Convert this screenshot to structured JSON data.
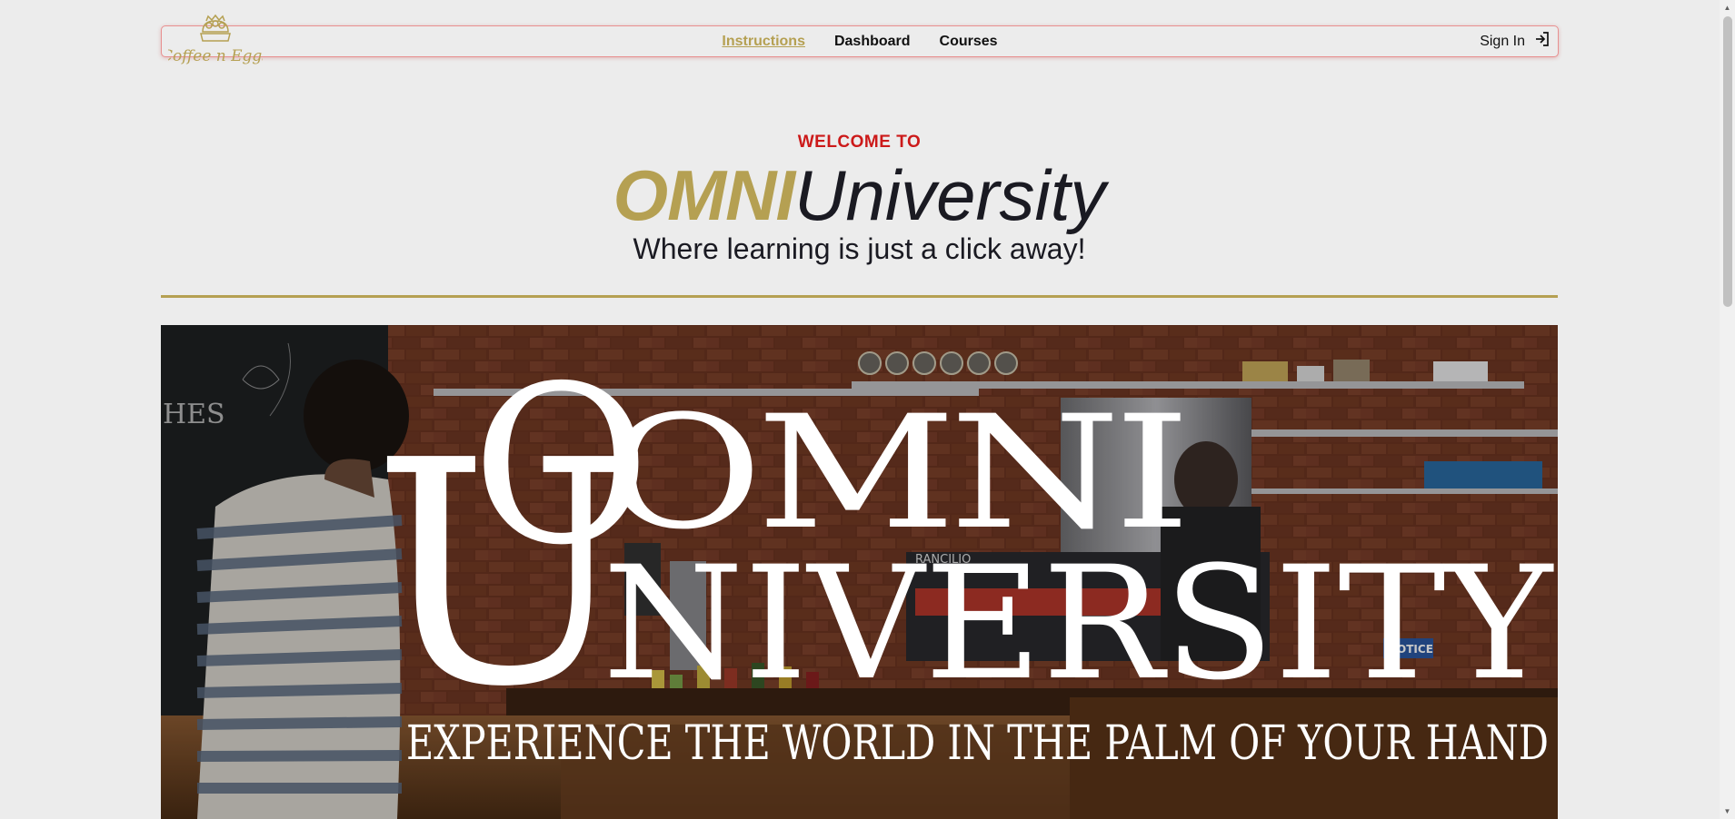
{
  "navbar": {
    "logo_text": "Coffee n Eggs",
    "links": [
      {
        "label": "Instructions",
        "active": true
      },
      {
        "label": "Dashboard",
        "active": false
      },
      {
        "label": "Courses",
        "active": false
      }
    ],
    "signin_label": "Sign In",
    "accent_color": "#b5a052"
  },
  "hero": {
    "welcome": "WELCOME TO",
    "brand_bold": "OMNI",
    "brand_regular": "University",
    "tagline": "Where learning is just a click away!"
  },
  "banner": {
    "title_line1": "OMNI",
    "title_line2": "NIVERSITY",
    "big_letter": "U",
    "big_o": "O",
    "slogan": "EXPERIENCE THE WORLD IN THE PALM OF YOUR HAND",
    "sign_text": "NOTICE",
    "machine_text": "RANCILIO",
    "chalk_text": "HES"
  }
}
